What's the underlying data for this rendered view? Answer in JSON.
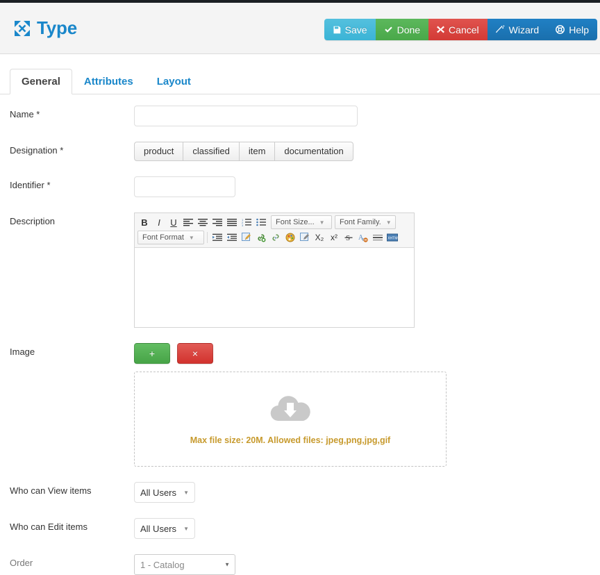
{
  "header": {
    "brand_icon": "arrows-expand-icon",
    "title": "Type",
    "buttons": [
      {
        "label": "Save",
        "icon": "floppy-disk-icon",
        "color": "#3bb4d6"
      },
      {
        "label": "Done",
        "icon": "check-icon",
        "color": "#49a849"
      },
      {
        "label": "Cancel",
        "icon": "times-icon",
        "color": "#d33a35"
      },
      {
        "label": "Wizard",
        "icon": "magic-wand-icon",
        "color": "#1a6fad"
      },
      {
        "label": "Help",
        "icon": "life-ring-icon",
        "color": "#1a6fad"
      }
    ]
  },
  "tabs": [
    {
      "label": "General",
      "active": true
    },
    {
      "label": "Attributes",
      "active": false
    },
    {
      "label": "Layout",
      "active": false
    }
  ],
  "form": {
    "name": {
      "label": "Name *",
      "value": "",
      "placeholder": ""
    },
    "designation": {
      "label": "Designation *",
      "options": [
        "product",
        "classified",
        "item",
        "documentation"
      ]
    },
    "identifier": {
      "label": "Identifier *",
      "value": "",
      "placeholder": ""
    },
    "description": {
      "label": "Description",
      "value": "",
      "toolbar_row1": [
        {
          "name": "bold-icon",
          "glyph": "B"
        },
        {
          "name": "italic-icon",
          "glyph": "I"
        },
        {
          "name": "underline-icon",
          "glyph": "U"
        },
        {
          "name": "align-left-icon",
          "glyph": ""
        },
        {
          "name": "align-center-icon",
          "glyph": ""
        },
        {
          "name": "align-right-icon",
          "glyph": ""
        },
        {
          "name": "align-justify-icon",
          "glyph": ""
        },
        {
          "name": "numbered-list-icon",
          "glyph": ""
        },
        {
          "name": "bulleted-list-icon",
          "glyph": ""
        }
      ],
      "font_size_label": "Font Size...",
      "font_family_label": "Font Family.",
      "font_format_label": "Font Format",
      "toolbar_row2": [
        {
          "name": "indent-increase-icon"
        },
        {
          "name": "indent-decrease-icon"
        },
        {
          "name": "edit-block-icon"
        },
        {
          "name": "link-icon"
        },
        {
          "name": "unlink-icon"
        },
        {
          "name": "text-color-icon"
        },
        {
          "name": "edit-source-icon"
        },
        {
          "name": "subscript-icon",
          "glyph": "X₂"
        },
        {
          "name": "superscript-icon",
          "glyph": "x²"
        },
        {
          "name": "strikethrough-icon",
          "glyph": "S"
        },
        {
          "name": "remove-format-icon"
        },
        {
          "name": "horizontal-rule-icon"
        },
        {
          "name": "xhtml-source-icon",
          "glyph": "XHTML"
        }
      ]
    },
    "image": {
      "label": "Image",
      "add_label": "+",
      "remove_label": "×",
      "dropzone_icon": "cloud-download-icon",
      "dropzone_text": "Max file size: 20M. Allowed files: jpeg,png,jpg,gif",
      "dropzone_text_color": "#c79a2d"
    },
    "who_view": {
      "label": "Who can View items",
      "value": "All Users"
    },
    "who_edit": {
      "label": "Who can Edit items",
      "value": "All Users"
    },
    "order": {
      "label": "Order",
      "value": "1 - Catalog"
    }
  }
}
